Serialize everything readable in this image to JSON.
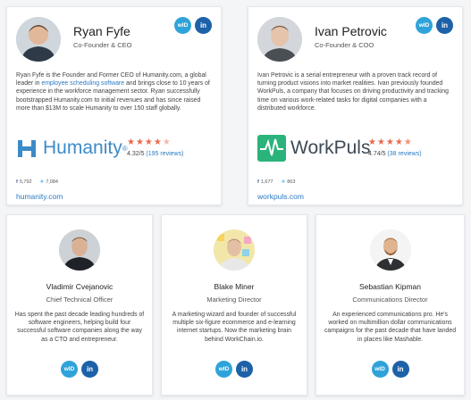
{
  "people": [
    {
      "name": "Ryan Fyfe",
      "role": "Co-Founder & CEO",
      "bio_before_link": "Ryan Fyfe is the Founder and Former CEO of Humanity.com, a global leader in ",
      "bio_link": "employee scheduling software",
      "bio_after_link": " and brings close to 10 years of experience in the workforce management sector. Ryan successfully bootstrapped Humanity.com to initial revenues and has since raised more than $13M to scale Humanity to over 150 staff globally.",
      "company_logo_text": "Humanity",
      "company_logo_mark": "®",
      "rating_value": "4.32/5",
      "rating_reviews": "(195 reviews)",
      "facebook_count": "5,792",
      "twitter_count": "7,084",
      "website": "humanity.com"
    },
    {
      "name": "Ivan Petrovic",
      "role": "Co-Founder & COO",
      "bio": "Ivan Petrovic is a serial entrepreneur with a proven track record of turning product visions into market realities. Ivan previously founded WorkPuls, a company that focuses on driving productivity and tracking time on various work-related tasks for digital companies with a distributed workforce.",
      "company_logo_text": "WorkPuls",
      "rating_value": "4.74/5",
      "rating_reviews": "(38 reviews)",
      "facebook_count": "1,677",
      "twitter_count": "863",
      "website": "workpuls.com"
    },
    {
      "name": "Vladimir Cvejanovic",
      "role": "Chief Technical Officer",
      "bio": "Has spent the past decade leading hundreds of software engineers, helping build four successful software companies along the way as a CTO and entrepreneur."
    },
    {
      "name": "Blake Miner",
      "role": "Marketing Director",
      "bio": "A marketing wizard and founder of successful multiple six-figure ecommerce and e-learning internet startups. Now the marketing brain behind WorkChain.io."
    },
    {
      "name": "Sebastian Kipman",
      "role": "Communications Director",
      "bio": "An experienced communications pro. He's worked on multimillion dollar communications campaigns for the past decade that have landed in places like Mashable."
    }
  ],
  "badges": {
    "wid_label": "wID",
    "in_label": "in"
  },
  "icons": {
    "facebook": "f",
    "twitter": "🐦"
  },
  "stars": "★★★★",
  "colors": {
    "link": "#2b7bc1",
    "star": "#e96a4d",
    "wid": "#2fa3d9",
    "linkedin": "#1d61a8"
  }
}
